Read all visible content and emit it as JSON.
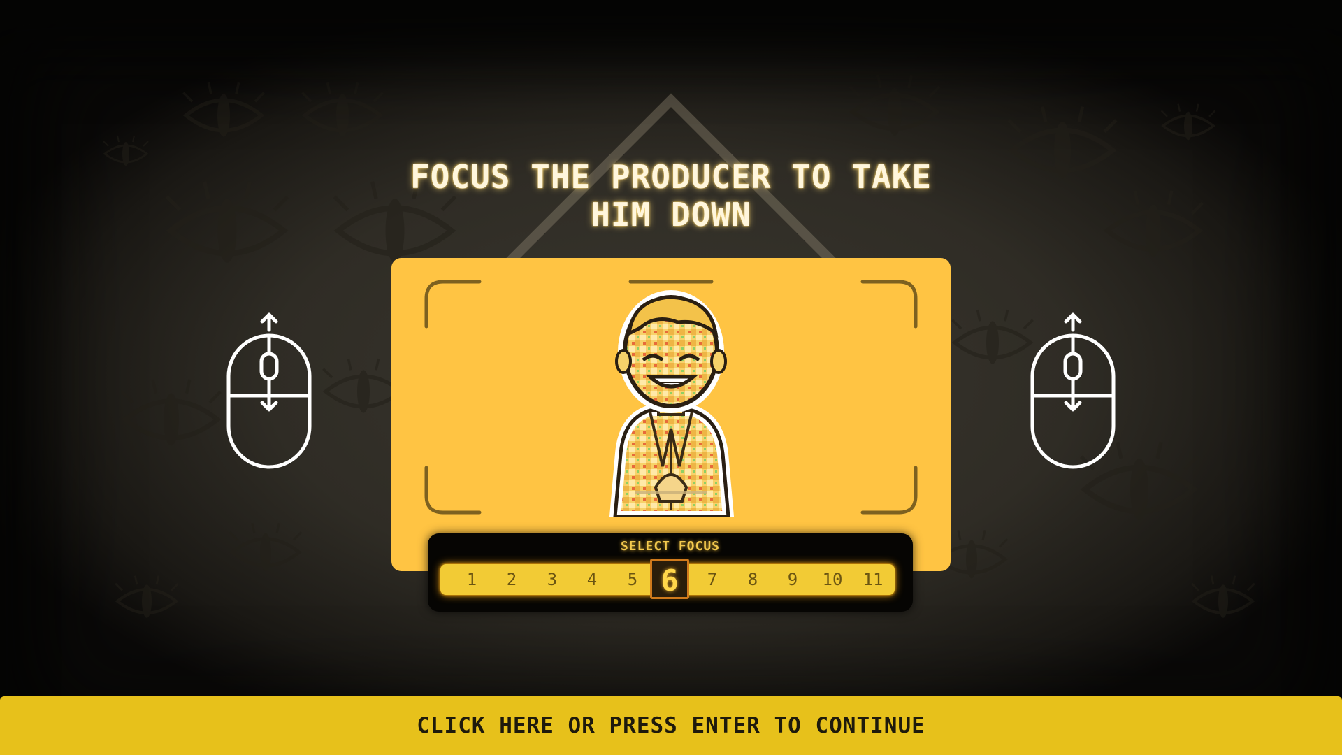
{
  "title": "FOCUS THE PRODUCER TO TAKE HIM DOWN",
  "focus_selector": {
    "label": "SELECT FOCUS",
    "options": [
      "1",
      "2",
      "3",
      "4",
      "5",
      "6",
      "7",
      "8",
      "9",
      "10",
      "11"
    ],
    "selected": "6"
  },
  "icons": {
    "left": "mouse-scroll-icon",
    "right": "mouse-scroll-icon",
    "target": "producer-character"
  },
  "continue_label": "CLICK HERE OR PRESS ENTER TO CONTINUE",
  "colors": {
    "accent": "#ffc443",
    "button": "#e7c11b",
    "title_glow": "#ffcf55",
    "selector_border": "#d07a1c"
  }
}
